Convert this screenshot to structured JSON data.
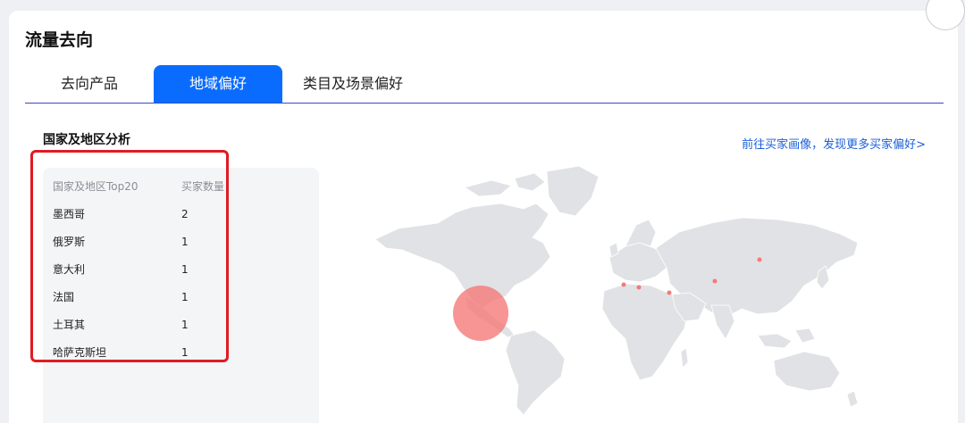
{
  "section": {
    "title": "流量去向"
  },
  "tabs": [
    {
      "label": "去向产品",
      "active": false
    },
    {
      "label": "地域偏好",
      "active": true
    },
    {
      "label": "类目及场景偏好",
      "active": false
    }
  ],
  "region": {
    "title": "国家及地区分析",
    "more_link": "前往买家画像，发现更多买家偏好>",
    "table": {
      "headers": [
        "国家及地区Top20",
        "买家数量"
      ],
      "rows": [
        {
          "name": "墨西哥",
          "count": "2"
        },
        {
          "name": "俄罗斯",
          "count": "1"
        },
        {
          "name": "意大利",
          "count": "1"
        },
        {
          "name": "法国",
          "count": "1"
        },
        {
          "name": "土耳其",
          "count": "1"
        },
        {
          "name": "哈萨克斯坦",
          "count": "1"
        }
      ]
    }
  },
  "colors": {
    "accent": "#0a6cff",
    "highlight": "#e01b22",
    "map_land": "#e1e2e5",
    "marker": "#f47a78"
  }
}
